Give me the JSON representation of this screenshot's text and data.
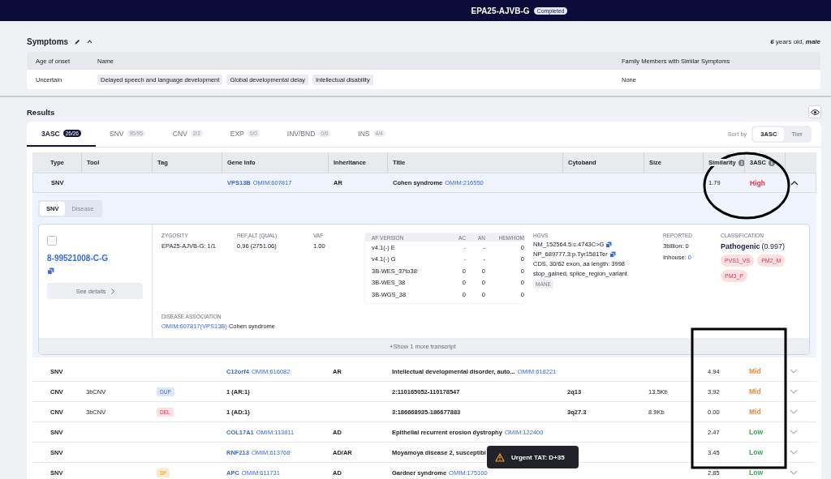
{
  "header": {
    "title": "EPA25-AJVB-G",
    "status": "Completed"
  },
  "symptoms": {
    "title": "Symptoms",
    "patient": "**6** years old, **male**",
    "columns": [
      "Age of onset",
      "Name",
      "Family Members with Similar Symptoms"
    ],
    "rows": [
      {
        "age_of_onset": "Uncertain",
        "names": [
          "Delayed speech and language development",
          "Global developmental delay",
          "Intellectual disability"
        ],
        "family": "None"
      }
    ]
  },
  "results": {
    "title": "Results",
    "tabs": [
      {
        "label": "3ASC",
        "count": "26/26",
        "selected": true
      },
      {
        "label": "SNV",
        "count": "95/95",
        "selected": false
      },
      {
        "label": "CNV",
        "count": "2/2",
        "selected": false
      },
      {
        "label": "EXP",
        "count": "0/0",
        "selected": false
      },
      {
        "label": "INV/BND",
        "count": "0/0",
        "selected": false
      },
      {
        "label": "INS",
        "count": "4/4",
        "selected": false
      }
    ],
    "sort": {
      "label": "Sort by",
      "options": [
        {
          "label": "3ASC",
          "selected": true
        },
        {
          "label": "Tier",
          "selected": false
        }
      ]
    },
    "columns": [
      {
        "label": "Type"
      },
      {
        "label": "Tool"
      },
      {
        "label": "Tag"
      },
      {
        "label": "Gene Info"
      },
      {
        "label": "Inheritance"
      },
      {
        "label": "Title"
      },
      {
        "label": "Cytoband"
      },
      {
        "label": "Size"
      },
      {
        "label": "Similarity",
        "info": true
      },
      {
        "label": "3ASC",
        "info": true
      }
    ],
    "rows": [
      {
        "type": "SNV",
        "gene": "VPS13B",
        "gene_omim": "OMIM:607817",
        "inheritance": "AR",
        "title": "Cohen syndrome",
        "title_omim": "OMIM:216550",
        "similarity": "1.79",
        "asc": "High",
        "color": "#e8344e",
        "expanded": true,
        "detail": {
          "tabs": [
            {
              "label": "SNV",
              "selected": true
            },
            {
              "label": "Disease",
              "selected": false
            }
          ],
          "checked": false,
          "variant": "8-99521008-C-G",
          "see_details": "See details",
          "fields": [
            {
              "label": "ZYGOSITY",
              "value": "EPA25-AJVB-G: 1/1"
            },
            {
              "label": "REF,ALT (QUAL)",
              "value": "0,96 (2751.06)"
            },
            {
              "label": "VAF",
              "value": "1.00"
            }
          ],
          "af_table": {
            "columns": [
              "AF VERSION",
              "AC",
              "AN",
              "HEM/HOM"
            ],
            "rows": [
              [
                "v4.1(-) E",
                "-",
                "-",
                "0"
              ],
              [
                "v4.1(-) G",
                "-",
                "-",
                "0"
              ],
              [
                "3B-WES_37to38",
                "0",
                "0",
                "0"
              ],
              [
                "3B-WES_38",
                "0",
                "0",
                "0"
              ],
              [
                "3B-WGS_38",
                "0",
                "0",
                "0"
              ]
            ]
          },
          "hgvs": {
            "label": "HGVS",
            "lines": [
              {
                "text": "NM_152564.5:c.4743C>G",
                "copy": true
              },
              {
                "text": "NP_689777.3:p.Tyr1581Ter",
                "copy": true
              },
              {
                "text": "CDS, 30/62 exon, aa length: 3998",
                "copy": false
              },
              {
                "text": "stop_gained, splice_region_variant",
                "copy": false
              }
            ],
            "tag": "MANE"
          },
          "reported": {
            "label": "REPORTED",
            "items": [
              {
                "label": "3billion:",
                "value": "0",
                "link": false
              },
              {
                "label": "Inhouse:",
                "value": "0",
                "link": true
              }
            ]
          },
          "classification": {
            "label": "CLASSIFICATION",
            "verdict": "Pathogenic",
            "score": "(0.997)",
            "criteria": [
              "PVS1_VS",
              "PM2_M",
              "PM3_P"
            ]
          },
          "disease": {
            "label": "DISEASE ASSOCIATION",
            "link": "OMIM:607817(VPS13B)",
            "text": "Cohen syndrome"
          },
          "more": "+Show 1 more transcript"
        }
      },
      {
        "type": "SNV",
        "gene": "C12orf4",
        "gene_omim": "OMIM:616082",
        "inheritance": "AR",
        "title": "Intellectual developmental disorder, auto...",
        "title_omim": "OMIM:618221",
        "similarity": "4.94",
        "asc": "Mid",
        "color": "#f0883a",
        "expanded": false
      },
      {
        "type": "CNV",
        "tool": "3bCNV",
        "tag": {
          "label": "DUP",
          "kind": "dup"
        },
        "gene": "1 (AR:1)",
        "title": "2:110165052-110178547",
        "cytoband": "2q13",
        "size": "13.5Kb",
        "similarity": "3.92",
        "asc": "Mid",
        "color": "#f0883a",
        "expanded": false
      },
      {
        "type": "CNV",
        "tool": "3bCNV",
        "tag": {
          "label": "DEL",
          "kind": "del"
        },
        "gene": "1 (AD:1)",
        "title": "3:186668935-186677883",
        "cytoband": "3q27.3",
        "size": "8.9Kb",
        "similarity": "0.00",
        "asc": "Mid",
        "color": "#f0883a",
        "expanded": false
      },
      {
        "type": "SNV",
        "gene": "COL17A1",
        "gene_omim": "OMIM:113811",
        "inheritance": "AD",
        "title": "Epithelial recurrent erosion dystrophy",
        "title_omim": "OMIM:122400",
        "similarity": "2.47",
        "asc": "Low",
        "color": "#3aa35a",
        "expanded": false
      },
      {
        "type": "SNV",
        "gene": "RNF213",
        "gene_omim": "OMIM:613768",
        "inheritance": "AD/AR",
        "title": "Moyamoya disease 2, susceptibi",
        "similarity": "3.45",
        "asc": "Low",
        "color": "#3aa35a",
        "expanded": false
      },
      {
        "type": "SNV",
        "tag": {
          "label": "SF",
          "kind": "sf"
        },
        "gene": "APC",
        "gene_omim": "OMIM:611731",
        "inheritance": "AD",
        "title": "Gardner syndrome",
        "title_omim": "OMIM:175100",
        "similarity": "2.85",
        "asc": "Low",
        "color": "#3aa35a",
        "expanded": false
      }
    ]
  },
  "toast": {
    "text": "Urgent TAT: D+35",
    "kind": "warning"
  }
}
